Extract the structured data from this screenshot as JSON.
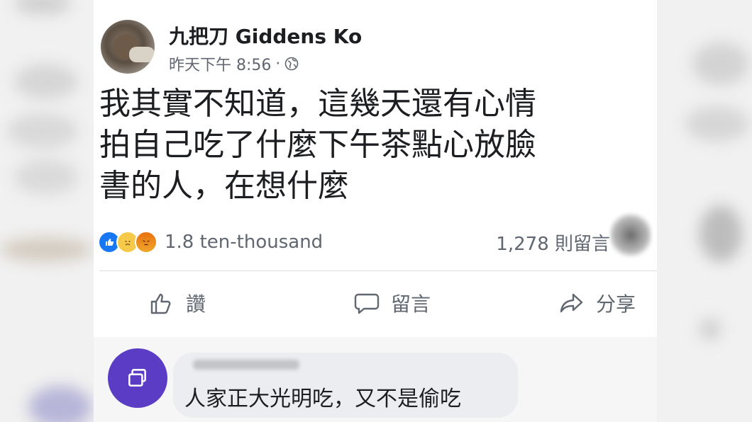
{
  "post": {
    "author": "九把刀 Giddens Ko",
    "timestamp": "昨天下午 8:56",
    "separator": "·",
    "privacy_icon": "globe-icon",
    "text_lines": [
      "我其實不知道，這幾天還有心情",
      "拍自己吃了什麼下午茶點心放臉",
      "書的人，在想什麼"
    ]
  },
  "stats": {
    "reaction_icons": [
      "like-icon",
      "sad-icon",
      "angry-icon"
    ],
    "reactions": "1.8 ten-thousand",
    "comments": "1,278 則留言"
  },
  "actions": {
    "like_label": "讚",
    "comment_label": "留言",
    "share_label": "分享"
  },
  "comment": {
    "avatar_icon": "copy-icon",
    "text": "人家正大光明吃，又不是偷吃"
  },
  "colors": {
    "like_blue": "#1877f2",
    "comment_avatar": "#5b3cc4",
    "muted_text": "#606770"
  }
}
